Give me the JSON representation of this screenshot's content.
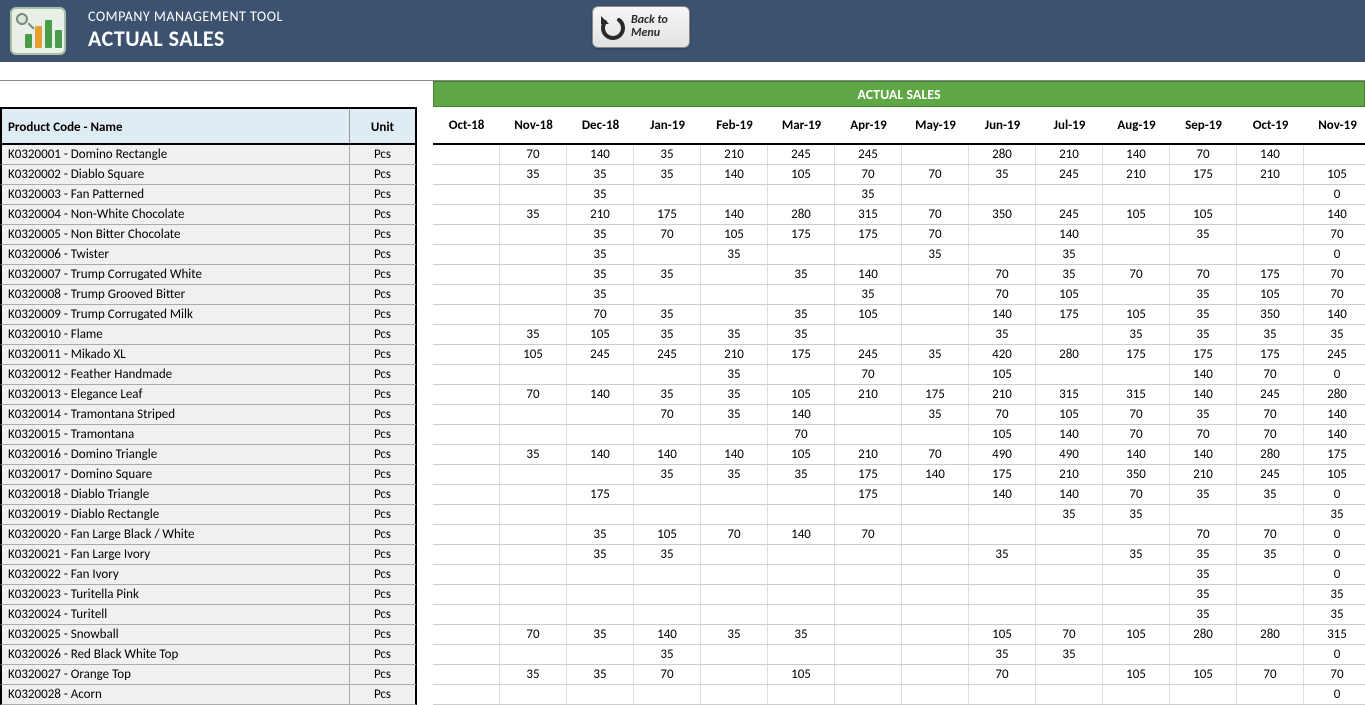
{
  "header": {
    "app_name": "COMPANY MANAGEMENT TOOL",
    "page_title": "ACTUAL SALES",
    "back_label": "Back to Menu"
  },
  "section_title": "ACTUAL SALES",
  "left_headers": {
    "product": "Product Code - Name",
    "unit": "Unit"
  },
  "months": [
    "Oct-18",
    "Nov-18",
    "Dec-18",
    "Jan-19",
    "Feb-19",
    "Mar-19",
    "Apr-19",
    "May-19",
    "Jun-19",
    "Jul-19",
    "Aug-19",
    "Sep-19",
    "Oct-19",
    "Nov-19"
  ],
  "rows": [
    {
      "name": "K0320001 - Domino Rectangle",
      "unit": "Pcs",
      "values": [
        "",
        "70",
        "140",
        "35",
        "210",
        "245",
        "245",
        "",
        "280",
        "210",
        "140",
        "70",
        "140",
        ""
      ]
    },
    {
      "name": "K0320002 - Diablo Square",
      "unit": "Pcs",
      "values": [
        "",
        "35",
        "35",
        "35",
        "140",
        "105",
        "70",
        "70",
        "35",
        "245",
        "210",
        "175",
        "210",
        "105"
      ]
    },
    {
      "name": "K0320003 - Fan Patterned",
      "unit": "Pcs",
      "values": [
        "",
        "",
        "35",
        "",
        "",
        "",
        "35",
        "",
        "",
        "",
        "",
        "",
        "",
        "0"
      ]
    },
    {
      "name": "K0320004 - Non-White Chocolate",
      "unit": "Pcs",
      "values": [
        "",
        "35",
        "210",
        "175",
        "140",
        "280",
        "315",
        "70",
        "350",
        "245",
        "105",
        "105",
        "",
        "140"
      ]
    },
    {
      "name": "K0320005 - Non Bitter Chocolate",
      "unit": "Pcs",
      "values": [
        "",
        "",
        "35",
        "70",
        "105",
        "175",
        "175",
        "70",
        "",
        "140",
        "",
        "35",
        "",
        "70"
      ]
    },
    {
      "name": "K0320006 - Twister",
      "unit": "Pcs",
      "values": [
        "",
        "",
        "35",
        "",
        "35",
        "",
        "",
        "35",
        "",
        "35",
        "",
        "",
        "",
        "0"
      ]
    },
    {
      "name": "K0320007 - Trump Corrugated White",
      "unit": "Pcs",
      "values": [
        "",
        "",
        "35",
        "35",
        "",
        "35",
        "140",
        "",
        "70",
        "35",
        "70",
        "70",
        "175",
        "70"
      ]
    },
    {
      "name": "K0320008 - Trump Grooved Bitter",
      "unit": "Pcs",
      "values": [
        "",
        "",
        "35",
        "",
        "",
        "",
        "35",
        "",
        "70",
        "105",
        "",
        "35",
        "105",
        "70"
      ]
    },
    {
      "name": "K0320009 - Trump Corrugated Milk",
      "unit": "Pcs",
      "values": [
        "",
        "",
        "70",
        "35",
        "",
        "35",
        "105",
        "",
        "140",
        "175",
        "105",
        "35",
        "350",
        "140"
      ]
    },
    {
      "name": "K0320010 - Flame",
      "unit": "Pcs",
      "values": [
        "",
        "35",
        "105",
        "35",
        "35",
        "35",
        "",
        "",
        "35",
        "",
        "35",
        "35",
        "35",
        "35"
      ]
    },
    {
      "name": "K0320011 - Mikado XL",
      "unit": "Pcs",
      "values": [
        "",
        "105",
        "245",
        "245",
        "210",
        "175",
        "245",
        "35",
        "420",
        "280",
        "175",
        "175",
        "175",
        "245"
      ]
    },
    {
      "name": "K0320012 - Feather Handmade",
      "unit": "Pcs",
      "values": [
        "",
        "",
        "",
        "",
        "35",
        "",
        "70",
        "",
        "105",
        "",
        "",
        "140",
        "70",
        "0"
      ]
    },
    {
      "name": "K0320013 - Elegance Leaf",
      "unit": "Pcs",
      "values": [
        "",
        "70",
        "140",
        "35",
        "35",
        "105",
        "210",
        "175",
        "210",
        "315",
        "315",
        "140",
        "245",
        "280"
      ]
    },
    {
      "name": "K0320014 - Tramontana Striped",
      "unit": "Pcs",
      "values": [
        "",
        "",
        "",
        "70",
        "35",
        "140",
        "",
        "35",
        "70",
        "105",
        "70",
        "35",
        "70",
        "140"
      ]
    },
    {
      "name": "K0320015 - Tramontana",
      "unit": "Pcs",
      "values": [
        "",
        "",
        "",
        "",
        "",
        "70",
        "",
        "",
        "105",
        "140",
        "70",
        "70",
        "70",
        "140"
      ]
    },
    {
      "name": "K0320016 - Domino Triangle",
      "unit": "Pcs",
      "values": [
        "",
        "35",
        "140",
        "140",
        "140",
        "105",
        "210",
        "70",
        "490",
        "490",
        "140",
        "140",
        "280",
        "175"
      ]
    },
    {
      "name": "K0320017 - Domino Square",
      "unit": "Pcs",
      "values": [
        "",
        "",
        "",
        "35",
        "35",
        "35",
        "175",
        "140",
        "175",
        "210",
        "350",
        "210",
        "245",
        "105"
      ]
    },
    {
      "name": "K0320018 - Diablo Triangle",
      "unit": "Pcs",
      "values": [
        "",
        "",
        "175",
        "",
        "",
        "",
        "175",
        "",
        "140",
        "140",
        "70",
        "35",
        "35",
        "0"
      ]
    },
    {
      "name": "K0320019 - Diablo Rectangle",
      "unit": "Pcs",
      "values": [
        "",
        "",
        "",
        "",
        "",
        "",
        "",
        "",
        "",
        "35",
        "35",
        "",
        "",
        "35"
      ]
    },
    {
      "name": "K0320020 - Fan Large Black / White",
      "unit": "Pcs",
      "values": [
        "",
        "",
        "35",
        "105",
        "70",
        "140",
        "70",
        "",
        "",
        "",
        "",
        "70",
        "70",
        "0"
      ]
    },
    {
      "name": "K0320021 - Fan Large Ivory",
      "unit": "Pcs",
      "values": [
        "",
        "",
        "35",
        "35",
        "",
        "",
        "",
        "",
        "35",
        "",
        "35",
        "35",
        "35",
        "0"
      ]
    },
    {
      "name": "K0320022 - Fan Ivory",
      "unit": "Pcs",
      "values": [
        "",
        "",
        "",
        "",
        "",
        "",
        "",
        "",
        "",
        "",
        "",
        "35",
        "",
        "0"
      ]
    },
    {
      "name": "K0320023 - Turitella Pink",
      "unit": "Pcs",
      "values": [
        "",
        "",
        "",
        "",
        "",
        "",
        "",
        "",
        "",
        "",
        "",
        "35",
        "",
        "35"
      ]
    },
    {
      "name": "K0320024 - Turitell",
      "unit": "Pcs",
      "values": [
        "",
        "",
        "",
        "",
        "",
        "",
        "",
        "",
        "",
        "",
        "",
        "35",
        "",
        "35"
      ]
    },
    {
      "name": "K0320025 - Snowball",
      "unit": "Pcs",
      "values": [
        "",
        "70",
        "35",
        "140",
        "35",
        "35",
        "",
        "",
        "105",
        "70",
        "105",
        "280",
        "280",
        "315"
      ]
    },
    {
      "name": "K0320026 - Red Black White Top",
      "unit": "Pcs",
      "values": [
        "",
        "",
        "",
        "35",
        "",
        "",
        "",
        "",
        "35",
        "35",
        "",
        "",
        "",
        "0"
      ]
    },
    {
      "name": "K0320027 - Orange Top",
      "unit": "Pcs",
      "values": [
        "",
        "35",
        "35",
        "70",
        "",
        "105",
        "",
        "",
        "70",
        "",
        "105",
        "105",
        "70",
        "70"
      ]
    },
    {
      "name": "K0320028 - Acorn",
      "unit": "Pcs",
      "values": [
        "",
        "",
        "",
        "",
        "",
        "",
        "",
        "",
        "",
        "",
        "",
        "",
        "",
        "0"
      ]
    }
  ]
}
